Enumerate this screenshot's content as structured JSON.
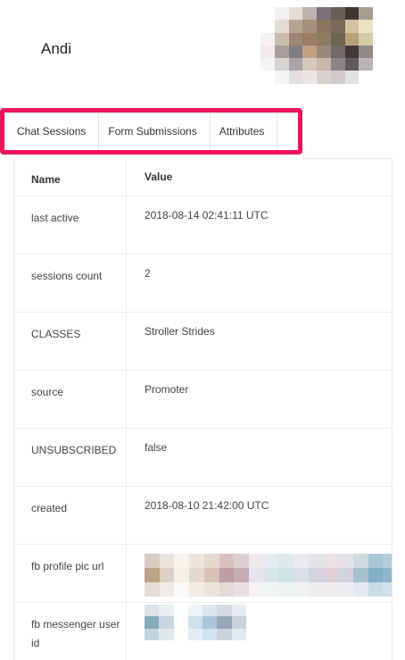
{
  "user": {
    "name": "Andi"
  },
  "tabs": [
    {
      "label": "Chat Sessions"
    },
    {
      "label": "Form Submissions"
    },
    {
      "label": "Attributes"
    }
  ],
  "table": {
    "headers": {
      "name": "Name",
      "value": "Value"
    },
    "rows": [
      {
        "name": "last active",
        "value": "2018-08-14 02:41:11 UTC"
      },
      {
        "name": "sessions count",
        "value": "2"
      },
      {
        "name": "CLASSES",
        "value": "Stroller Strides"
      },
      {
        "name": "source",
        "value": "Promoter"
      },
      {
        "name": "UNSUBSCRIBED",
        "value": "false"
      },
      {
        "name": "created",
        "value": "2018-08-10 21:42:00 UTC"
      },
      {
        "name": "fb profile pic url",
        "value": ""
      },
      {
        "name": "fb messenger user id",
        "value": ""
      }
    ]
  },
  "colors": {
    "highlight_border": "#f0145a"
  }
}
